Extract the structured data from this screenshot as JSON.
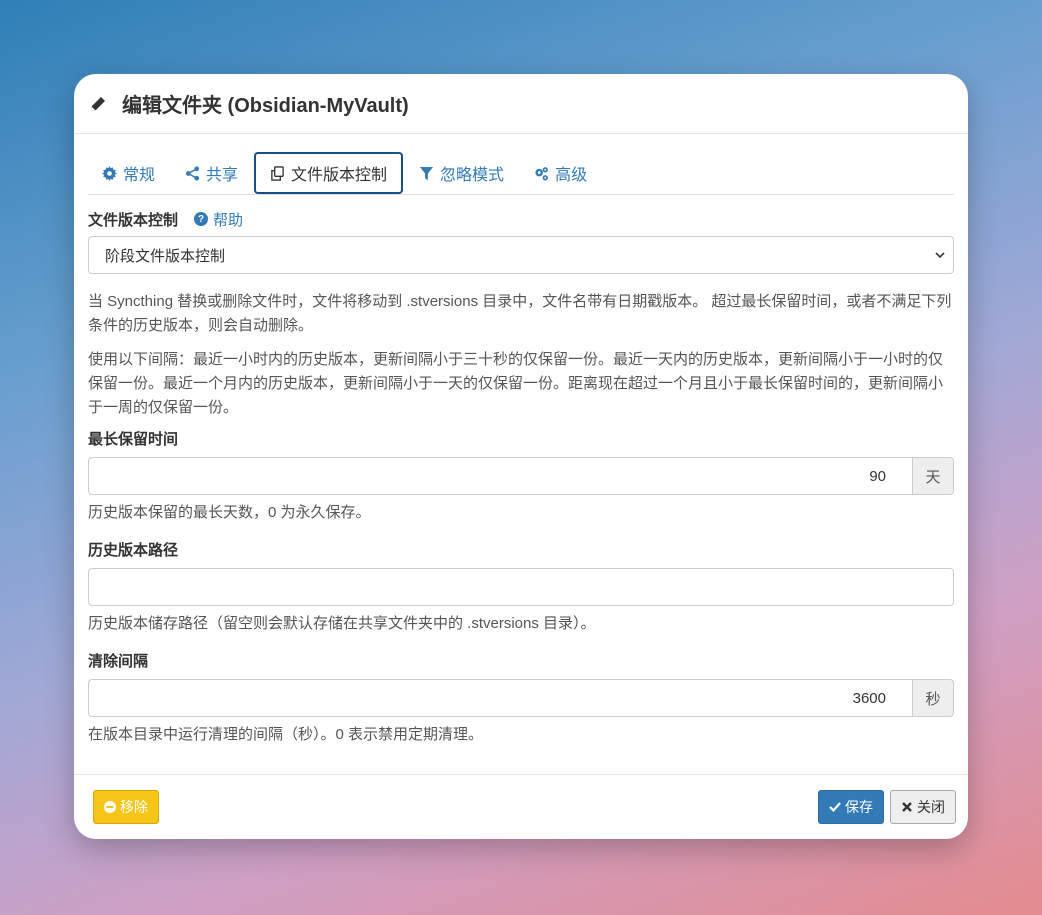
{
  "dialog": {
    "title": "编辑文件夹 (Obsidian-MyVault)"
  },
  "tabs": [
    {
      "label": "常规",
      "icon": "gear-icon"
    },
    {
      "label": "共享",
      "icon": "share-icon"
    },
    {
      "label": "文件版本控制",
      "icon": "copy-icon",
      "active": true
    },
    {
      "label": "忽略模式",
      "icon": "filter-icon"
    },
    {
      "label": "高级",
      "icon": "gears-icon"
    }
  ],
  "versioning": {
    "label": "文件版本控制",
    "help": "帮助",
    "selected": "阶段文件版本控制",
    "desc1": "当 Syncthing 替换或删除文件时，文件将移动到 .stversions 目录中，文件名带有日期戳版本。 超过最长保留时间，或者不满足下列条件的历史版本，则会自动删除。",
    "desc2": "使用以下间隔：最近一小时内的历史版本，更新间隔小于三十秒的仅保留一份。最近一天内的历史版本，更新间隔小于一小时的仅保留一份。最近一个月内的历史版本，更新间隔小于一天的仅保留一份。距离现在超过一个月且小于最长保留时间的，更新间隔小于一周的仅保留一份。"
  },
  "max_age": {
    "label": "最长保留时间",
    "value": "90",
    "unit": "天",
    "hint": "历史版本保留的最长天数，0 为永久保存。"
  },
  "path": {
    "label": "历史版本路径",
    "value": "",
    "hint": "历史版本储存路径（留空则会默认存储在共享文件夹中的 .stversions 目录）。"
  },
  "cleanup": {
    "label": "清除间隔",
    "value": "3600",
    "unit": "秒",
    "hint": "在版本目录中运行清理的间隔（秒）。0 表示禁用定期清理。"
  },
  "footer": {
    "remove": "移除",
    "save": "保存",
    "close": "关闭"
  },
  "colors": {
    "link": "#337ab7",
    "remove": "#f5c518",
    "save": "#337ab7"
  }
}
